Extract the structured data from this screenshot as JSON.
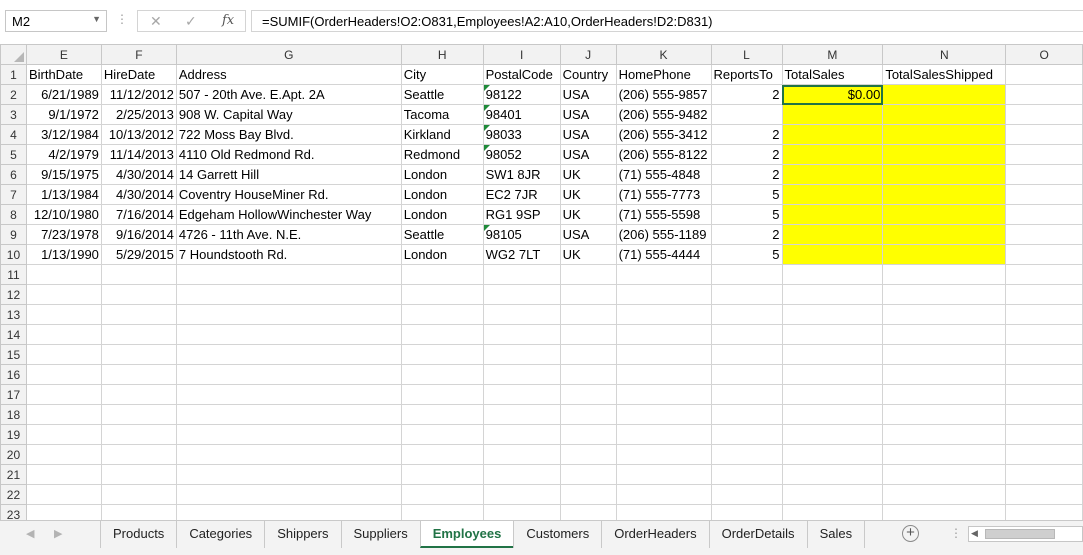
{
  "formula_bar": {
    "name_box": "M2",
    "formula": "=SUMIF(OrderHeaders!O2:O831,Employees!A2:A10,OrderHeaders!D2:D831)"
  },
  "grid": {
    "columns": [
      "E",
      "F",
      "G",
      "H",
      "I",
      "J",
      "K",
      "L",
      "M",
      "N",
      "O"
    ],
    "header_row": [
      "BirthDate",
      "HireDate",
      "Address",
      "City",
      "PostalCode",
      "Country",
      "HomePhone",
      "ReportsTo",
      "TotalSales",
      "TotalSalesShipped",
      ""
    ],
    "rows": [
      [
        "6/21/1989",
        "11/12/2012",
        "507 - 20th Ave. E.Apt. 2A",
        "Seattle",
        "98122",
        "USA",
        "(206) 555-9857",
        "2",
        "$0.00",
        "",
        ""
      ],
      [
        "9/1/1972",
        "2/25/2013",
        "908 W. Capital Way",
        "Tacoma",
        "98401",
        "USA",
        "(206) 555-9482",
        "",
        "",
        "",
        ""
      ],
      [
        "3/12/1984",
        "10/13/2012",
        "722 Moss Bay Blvd.",
        "Kirkland",
        "98033",
        "USA",
        "(206) 555-3412",
        "2",
        "",
        "",
        ""
      ],
      [
        "4/2/1979",
        "11/14/2013",
        "4110 Old Redmond Rd.",
        "Redmond",
        "98052",
        "USA",
        "(206) 555-8122",
        "2",
        "",
        "",
        ""
      ],
      [
        "9/15/1975",
        "4/30/2014",
        "14 Garrett Hill",
        "London",
        "SW1 8JR",
        "UK",
        "(71) 555-4848",
        "2",
        "",
        "",
        ""
      ],
      [
        "1/13/1984",
        "4/30/2014",
        "Coventry HouseMiner Rd.",
        "London",
        "EC2 7JR",
        "UK",
        "(71) 555-7773",
        "5",
        "",
        "",
        ""
      ],
      [
        "12/10/1980",
        "7/16/2014",
        "Edgeham HollowWinchester Way",
        "London",
        "RG1 9SP",
        "UK",
        "(71) 555-5598",
        "5",
        "",
        "",
        ""
      ],
      [
        "7/23/1978",
        "9/16/2014",
        "4726 - 11th Ave. N.E.",
        "Seattle",
        "98105",
        "USA",
        "(206) 555-1189",
        "2",
        "",
        "",
        ""
      ],
      [
        "1/13/1990",
        "5/29/2015",
        "7 Houndstooth Rd.",
        "London",
        "WG2 7LT",
        "UK",
        "(71) 555-4444",
        "5",
        "",
        "",
        ""
      ]
    ],
    "row_numbers": [
      "1",
      "2",
      "3",
      "4",
      "5",
      "6",
      "7",
      "8",
      "9",
      "10",
      "11",
      "12",
      "13",
      "14",
      "15",
      "16",
      "17",
      "18",
      "19",
      "20",
      "21",
      "22",
      "23"
    ],
    "highlight_color": "#ffff00",
    "number_stored_as_text_rows": [
      0,
      1,
      2,
      3,
      7
    ]
  },
  "sheet_tabs": {
    "tabs": [
      "Products",
      "Categories",
      "Shippers",
      "Suppliers",
      "Employees",
      "Customers",
      "OrderHeaders",
      "OrderDetails",
      "Sales"
    ],
    "active": "Employees",
    "add_sheet": "+"
  },
  "icons": {
    "cancel": "x-mark-icon",
    "enter": "check-icon",
    "function": "fx-icon",
    "add": "plus-circle-icon"
  },
  "accent_color": "#217346"
}
